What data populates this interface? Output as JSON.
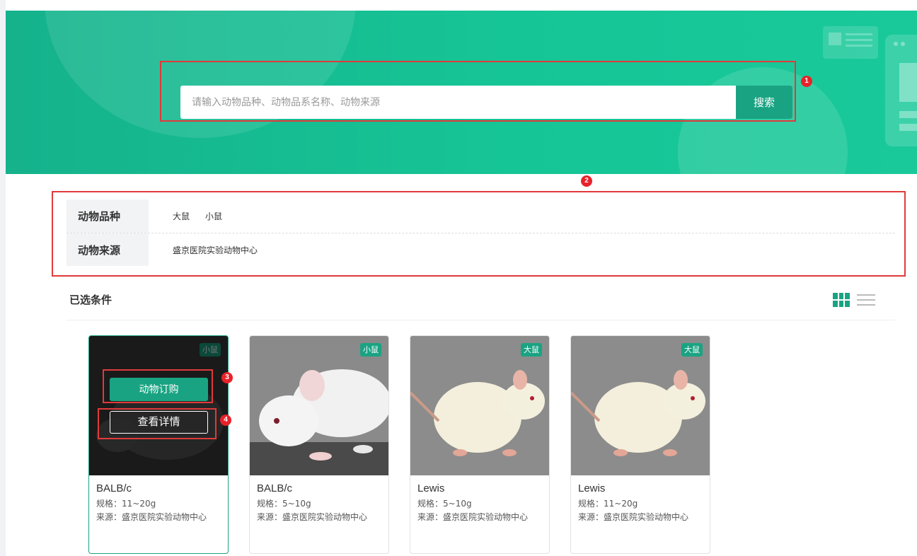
{
  "search": {
    "placeholder": "请输入动物品种、动物品系名称、动物来源",
    "button_label": "搜索"
  },
  "filters": {
    "species": {
      "label": "动物品种",
      "options": [
        "大鼠",
        "小鼠"
      ]
    },
    "source": {
      "label": "动物来源",
      "options": [
        "盛京医院实验动物中心"
      ]
    }
  },
  "selected": {
    "title": "已选条件"
  },
  "cards": [
    {
      "tag": "小鼠",
      "name": "BALB/c",
      "spec": "规格：11~20g",
      "source": "来源：盛京医院实验动物中心",
      "order_label": "动物订购",
      "detail_label": "查看详情"
    },
    {
      "tag": "小鼠",
      "name": "BALB/c",
      "spec": "规格：5~10g",
      "source": "来源：盛京医院实验动物中心"
    },
    {
      "tag": "大鼠",
      "name": "Lewis",
      "spec": "规格：5~10g",
      "source": "来源：盛京医院实验动物中心"
    },
    {
      "tag": "大鼠",
      "name": "Lewis",
      "spec": "规格：11~20g",
      "source": "来源：盛京医院实验动物中心"
    }
  ],
  "annotations": [
    "1",
    "2",
    "3",
    "4"
  ],
  "colors": {
    "brand": "#1aa382",
    "annotation": "#e03a3a"
  }
}
